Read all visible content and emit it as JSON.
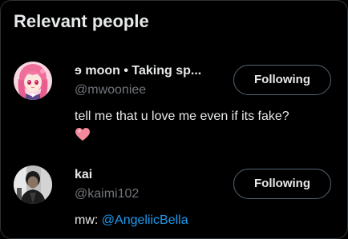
{
  "panel": {
    "title": "Relevant people"
  },
  "users": [
    {
      "display_name": "ɘ moon • Taking sp...",
      "handle": "@mwooniee",
      "bio": "tell me that u love me even if its fake?",
      "bio_emoji": "heart-emoji",
      "follow_label": "Following",
      "avatar": "anime-girl-pink-hair-avatar"
    },
    {
      "display_name": "kai",
      "handle": "@kaimi102",
      "bio_prefix": "mw: ",
      "bio_mention": "@AngeliicBella",
      "follow_label": "Following",
      "avatar": "photo-person-avatar"
    }
  ],
  "colors": {
    "background": "#000000",
    "primary_text": "#e7e9ea",
    "secondary_text": "#71767b",
    "link": "#1d9bf0",
    "button_border": "#536471",
    "heart": "#f4899b"
  }
}
